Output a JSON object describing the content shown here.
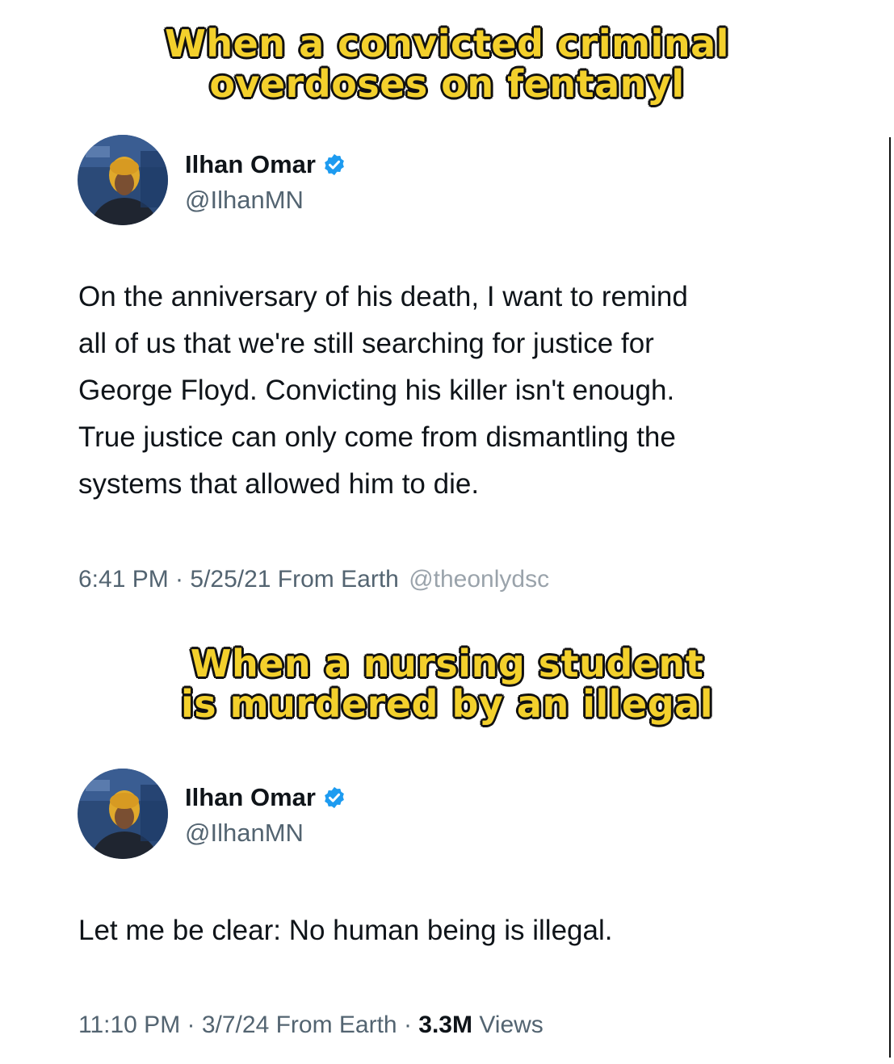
{
  "captions": [
    [
      "When a convicted criminal",
      "overdoses on fentanyl"
    ],
    [
      "When a nursing student",
      "is murdered by an illegal"
    ]
  ],
  "tweets": [
    {
      "name": "Ilhan Omar",
      "handle": "@IlhanMN",
      "body_lines": [
        "On the anniversary of his death, I want to remind",
        "all of us that we're still searching for justice for",
        "George Floyd. Convicting his killer isn't enough.",
        "True justice can only come from dismantling the",
        "systems that allowed him to die."
      ],
      "meta": "6:41 PM · 5/25/21 From Earth",
      "watermark": "@theonlydsc"
    },
    {
      "name": "Ilhan Omar",
      "handle": "@IlhanMN",
      "body_lines": [
        "Let me be clear: No human being is illegal."
      ],
      "meta": "11:10 PM · 3/7/24 From Earth · ",
      "views_count": "3.3M",
      "views_label": " Views"
    }
  ],
  "icons": {
    "verified": "verified-badge-icon",
    "avatar": "profile-photo"
  },
  "colors": {
    "caption_fill": "#f3d02c",
    "caption_outline": "#111111",
    "verified_blue": "#1d9bf0",
    "secondary_text": "#536471",
    "primary_text": "#0f1419"
  }
}
